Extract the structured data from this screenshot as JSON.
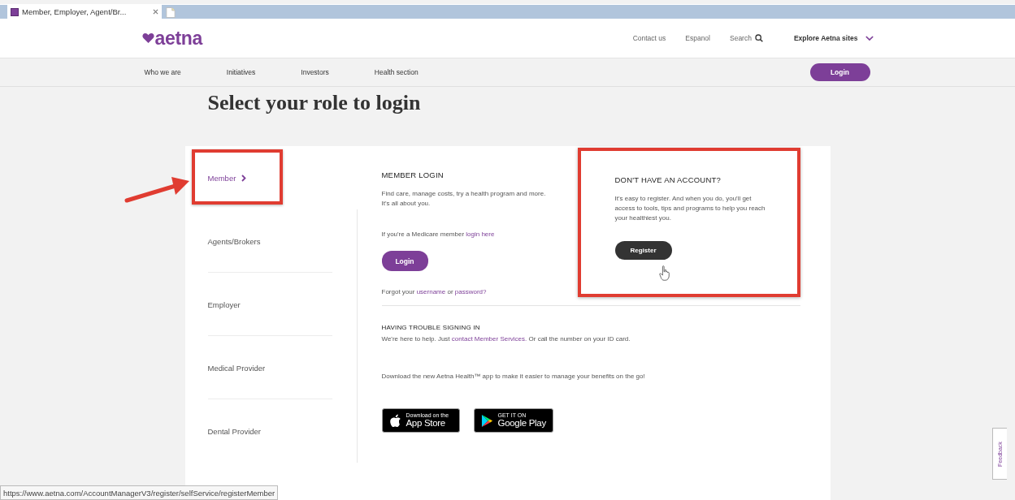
{
  "browser": {
    "tab_title": "Member, Employer, Agent/Br...",
    "status_url": "https://www.aetna.com/AccountManagerV3/register/selfService/registerMember"
  },
  "header": {
    "logo": "aetna",
    "links": [
      "Contact us",
      "Espanol"
    ],
    "search": "Search",
    "explore": "Explore Aetna sites"
  },
  "nav": {
    "items": [
      "Who we are",
      "Initiatives",
      "Investors",
      "Health section"
    ],
    "login_button": "Login"
  },
  "page_title": "Select your role to login",
  "roles": [
    {
      "label": "Member",
      "selected": true,
      "annotated": true
    },
    {
      "label": "Agents/Brokers",
      "selected": false,
      "annotated": false
    },
    {
      "label": "Employer",
      "selected": false,
      "annotated": false
    },
    {
      "label": "Medical Provider",
      "selected": false,
      "annotated": false
    },
    {
      "label": "Dental Provider",
      "selected": false,
      "annotated": false
    }
  ],
  "member_login": {
    "heading": "MEMBER LOGIN",
    "description": "Find care, manage costs, try a health program and more. It's all about you.",
    "medicare_text": "If you're a Medicare member ",
    "medicare_link": "login here",
    "login_button": "Login",
    "forgot_text": "Forgot your ",
    "username_link": "username",
    "or_text": " or ",
    "password_link": "password?"
  },
  "register": {
    "annotated": true,
    "heading": "DON'T HAVE AN ACCOUNT?",
    "description": "It's easy to register. And when you do, you'll get access to tools, tips and programs to help you reach your healthiest you.",
    "button": "Register"
  },
  "trouble": {
    "heading": "HAVING TROUBLE SIGNING IN",
    "text_before": "We're here to help. Just ",
    "link": "contact Member Services.",
    "text_after": " Or call the number on your ID card."
  },
  "app_promo": {
    "text": "Download the new Aetna Health™ app to make it easier to manage your benefits on the go!",
    "badges": [
      {
        "kind": "apple",
        "small": "Download on the",
        "big": "App Store"
      },
      {
        "kind": "google",
        "small": "GET IT ON",
        "big": "Google Play"
      }
    ]
  },
  "feedback": "Feedback"
}
